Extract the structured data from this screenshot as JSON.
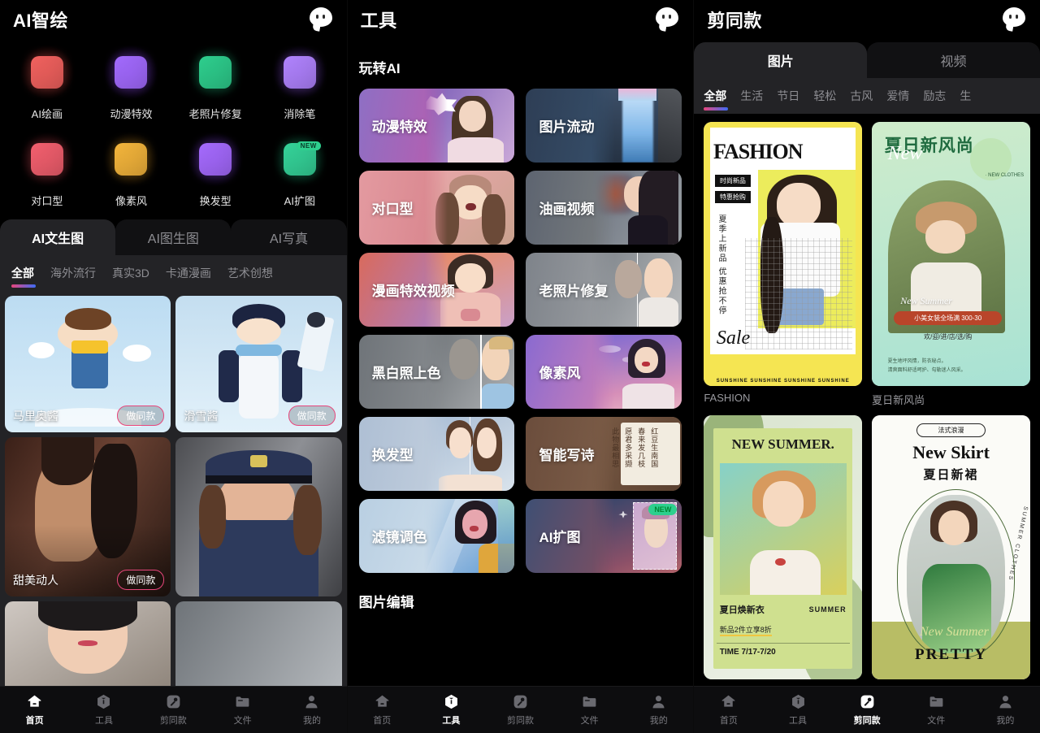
{
  "panels": {
    "left": {
      "header": {
        "title": "AI智绘",
        "chat_icon": "chat-bubble-icon"
      },
      "shortcuts": [
        {
          "label": "AI绘画",
          "icon": "pen-draw-icon",
          "glow": "#4a1412",
          "tile": "#f2625f"
        },
        {
          "label": "动漫特效",
          "icon": "bear-anime-icon",
          "glow": "#33105e",
          "tile": "#a36bff"
        },
        {
          "label": "老照片修复",
          "icon": "wrench-photo-icon",
          "glow": "#06301f",
          "tile": "#2ecf8e"
        },
        {
          "label": "消除笔",
          "icon": "eraser-icon",
          "glow": "#2a1050",
          "tile": "#b184ff"
        },
        {
          "label": "对口型",
          "icon": "lips-icon",
          "glow": "#3d1014",
          "tile": "#f4606f"
        },
        {
          "label": "像素风",
          "icon": "pixel-smile-icon",
          "glow": "#3a2405",
          "tile": "#f5b63c"
        },
        {
          "label": "换发型",
          "icon": "hair-icon",
          "glow": "#2a0f52",
          "tile": "#a66bff"
        },
        {
          "label": "AI扩图",
          "icon": "expand-arrows-icon",
          "glow": "#05301f",
          "tile": "#35d49a",
          "badge": "NEW"
        }
      ],
      "tabs": [
        {
          "label": "AI文生图",
          "active": true
        },
        {
          "label": "AI图生图",
          "active": false
        },
        {
          "label": "AI写真",
          "active": false
        }
      ],
      "filters": [
        {
          "label": "全部",
          "active": true
        },
        {
          "label": "海外流行",
          "active": false
        },
        {
          "label": "真实3D",
          "active": false
        },
        {
          "label": "卡通漫画",
          "active": false
        },
        {
          "label": "艺术创想",
          "active": false
        }
      ],
      "cards": [
        {
          "caption": "马里奥酱",
          "pill": "做同款",
          "theme": "anime-girl-overalls"
        },
        {
          "caption": "滑雪酱",
          "pill": "做同款",
          "theme": "anime-girl-ski"
        },
        {
          "caption": "甜美动人",
          "pill": "做同款",
          "theme": "portrait-warm"
        },
        {
          "caption": "",
          "pill": "",
          "theme": "police-portrait"
        },
        {
          "caption": "",
          "pill": "",
          "theme": "portrait-closeup"
        },
        {
          "caption": "",
          "pill": "",
          "theme": "portrait-grey"
        }
      ]
    },
    "mid": {
      "header": {
        "title": "工具",
        "chat_icon": "chat-bubble-icon"
      },
      "sections": [
        {
          "title": "玩转AI",
          "tools": [
            {
              "label": "动漫特效",
              "art": "anime-effect"
            },
            {
              "label": "图片流动",
              "art": "waterfall"
            },
            {
              "label": "对口型",
              "art": "lipsync"
            },
            {
              "label": "油画视频",
              "art": "oilpaint"
            },
            {
              "label": "漫画特效视频",
              "art": "comic"
            },
            {
              "label": "老照片修复",
              "art": "restore"
            },
            {
              "label": "黑白照上色",
              "art": "colorize"
            },
            {
              "label": "像素风",
              "art": "pixel"
            },
            {
              "label": "换发型",
              "art": "hairstyle"
            },
            {
              "label": "智能写诗",
              "art": "poem",
              "poem_lines": [
                "红豆生南国",
                "春来发几枝",
                "愿君多采撷",
                "此物最相思"
              ]
            },
            {
              "label": "滤镜调色",
              "art": "filter"
            },
            {
              "label": "AI扩图",
              "art": "expand",
              "badge": "NEW"
            }
          ]
        },
        {
          "title": "图片编辑",
          "tools": []
        }
      ]
    },
    "right": {
      "header": {
        "title": "剪同款",
        "chat_icon": "chat-bubble-icon"
      },
      "tabs": [
        {
          "label": "图片",
          "active": true
        },
        {
          "label": "视频",
          "active": false
        }
      ],
      "filters": [
        {
          "label": "全部",
          "active": true
        },
        {
          "label": "生活",
          "active": false
        },
        {
          "label": "节日",
          "active": false
        },
        {
          "label": "轻松",
          "active": false
        },
        {
          "label": "古风",
          "active": false
        },
        {
          "label": "爱情",
          "active": false
        },
        {
          "label": "励志",
          "active": false
        },
        {
          "label": "生",
          "active": false
        }
      ],
      "templates": [
        {
          "caption": "FASHION",
          "theme": "fashion-yellow",
          "texts": {
            "title": "FASHION",
            "tag1": "时尚新品",
            "tag2": "特惠抢购",
            "vertical": "夏季上新品 优惠抢不停",
            "script": "Sale",
            "footer": "SUNSHINE SUNSHINE SUNSHINE SUNSHINE"
          }
        },
        {
          "caption": "夏日新风尚",
          "theme": "summer-green",
          "texts": {
            "title": "夏日新风尚",
            "script": "New",
            "corner": "· NEW CLOTHES",
            "sub": "New Summer",
            "promo": "小美女装全场满 300-30",
            "slash": "欢/迎/进/店/选/购",
            "note": "夏生地坪风情，防衣秘点。\n清爽面料舒适呵护、勾勒迷人风采。"
          }
        },
        {
          "caption": "",
          "theme": "new-summer-green",
          "texts": {
            "title": "NEW SUMMER.",
            "label1": "夏日焕新衣",
            "label2": "SUMMER",
            "sub": "新品2件立享8折",
            "time": "TIME 7/17-7/20"
          }
        },
        {
          "caption": "",
          "theme": "new-skirt-white",
          "texts": {
            "badge": "法式浪漫",
            "title": "New Skirt",
            "subtitle": "夏日新裙",
            "arc": "SUMMER CLOTHES",
            "script": "New Summer",
            "footer": "PRETTY"
          }
        }
      ]
    }
  },
  "bottom_nav": {
    "items": [
      {
        "label": "首页",
        "icon": "home-icon"
      },
      {
        "label": "工具",
        "icon": "tools-icon"
      },
      {
        "label": "剪同款",
        "icon": "magic-key-icon"
      },
      {
        "label": "文件",
        "icon": "folder-icon"
      },
      {
        "label": "我的",
        "icon": "person-icon"
      }
    ],
    "active_index_left": 0,
    "active_index_mid": 1,
    "active_index_right": 2
  },
  "colors": {
    "accent_pink": "#e8467c",
    "accent_blue": "#3d6bf5",
    "green_badge": "#2ecf8e",
    "panel_bg": "#232326",
    "screen_bg": "#000000"
  }
}
